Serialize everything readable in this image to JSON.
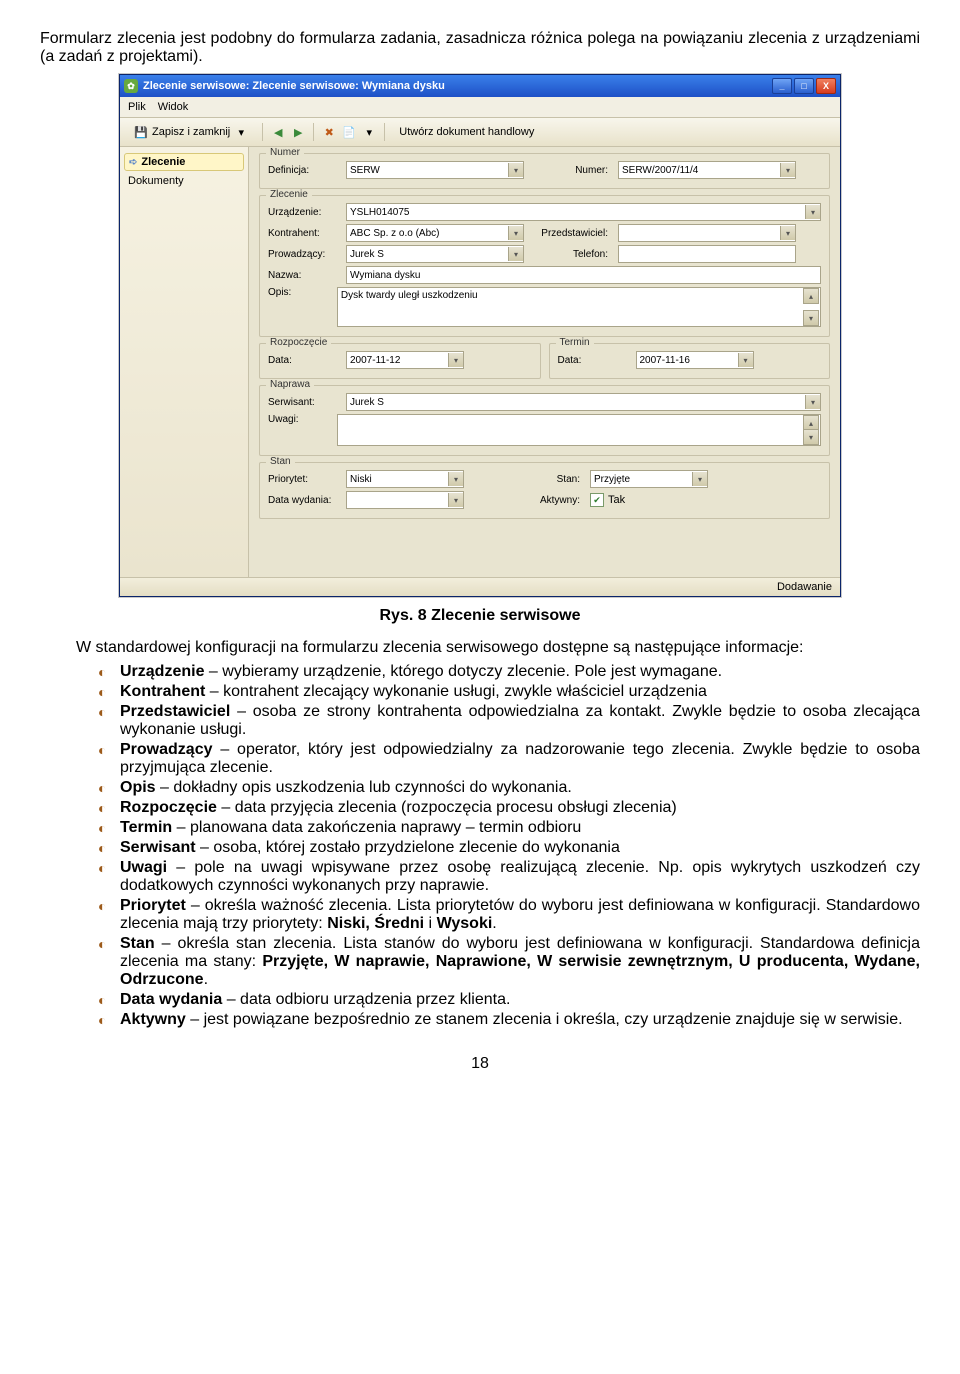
{
  "intro_text": "Formularz zlecenia jest podobny do formularza zadania, zasadnicza różnica polega na powiązaniu zlecenia z urządzeniami (a zadań z projektami).",
  "window": {
    "title": "Zlecenie serwisowe: Zlecenie serwisowe: Wymiana dysku",
    "win_min": "_",
    "win_max": "□",
    "win_close": "X",
    "menubar": {
      "plik": "Plik",
      "widok": "Widok"
    },
    "toolbar": {
      "save_close": "Zapisz i zamknij",
      "create_doc": "Utwórz dokument handlowy"
    },
    "sidebar": {
      "zlecenie": "Zlecenie",
      "dokumenty": "Dokumenty"
    },
    "form": {
      "numer_group": "Numer",
      "definicja_label": "Definicja:",
      "definicja_value": "SERW",
      "numer_label": "Numer:",
      "numer_value": "SERW/2007/11/4",
      "zlecenie_group": "Zlecenie",
      "urzadzenie_label": "Urządzenie:",
      "urzadzenie_value": "YSLH014075",
      "kontrahent_label": "Kontrahent:",
      "kontrahent_value": "ABC Sp. z o.o (Abc)",
      "przedstawiciel_label": "Przedstawiciel:",
      "przedstawiciel_value": "",
      "prowadzacy_label": "Prowadzący:",
      "prowadzacy_value": "Jurek S",
      "telefon_label": "Telefon:",
      "telefon_value": "",
      "nazwa_label": "Nazwa:",
      "nazwa_value": "Wymiana dysku",
      "opis_label": "Opis:",
      "opis_value": "Dysk twardy uległ uszkodzeniu",
      "rozpoczecie_group": "Rozpoczęcie",
      "termin_group": "Termin",
      "data_label": "Data:",
      "rozp_data_value": "2007-11-12",
      "term_data_value": "2007-11-16",
      "naprawa_group": "Naprawa",
      "serwisant_label": "Serwisant:",
      "serwisant_value": "Jurek S",
      "uwagi_label": "Uwagi:",
      "uwagi_value": "",
      "stan_group": "Stan",
      "priorytet_label": "Priorytet:",
      "priorytet_value": "Niski",
      "stan_label": "Stan:",
      "stan_value": "Przyjęte",
      "data_wydania_label": "Data wydania:",
      "data_wydania_value": "",
      "aktywny_label": "Aktywny:",
      "tak": "Tak"
    },
    "status": "Dodawanie"
  },
  "caption": "Rys. 8 Zlecenie serwisowe",
  "intro2a": "W standardowej konfiguracji na formularzu zlecenia serwisowego dostępne są następujące informacje:",
  "bullets": [
    {
      "bold": "Urządzenie",
      "text": " – wybieramy urządzenie, którego dotyczy zlecenie. Pole jest wymagane."
    },
    {
      "bold": "Kontrahent",
      "text": " – kontrahent zlecający wykonanie usługi, zwykle właściciel urządzenia"
    },
    {
      "bold": "Przedstawiciel",
      "text": " – osoba ze strony kontrahenta odpowiedzialna za kontakt. Zwykle będzie to osoba zlecająca wykonanie usługi."
    },
    {
      "bold": "Prowadzący",
      "text": " – operator, który jest odpowiedzialny za nadzorowanie tego zlecenia. Zwykle będzie to osoba przyjmująca zlecenie."
    },
    {
      "bold": "Opis",
      "text": " – dokładny opis uszkodzenia lub czynności do wykonania."
    },
    {
      "bold": "Rozpoczęcie",
      "text": " – data przyjęcia zlecenia (rozpoczęcia procesu obsługi zlecenia)"
    },
    {
      "bold": "Termin",
      "text": " – planowana data zakończenia naprawy – termin odbioru"
    },
    {
      "bold": "Serwisant",
      "text": " – osoba, której zostało przydzielone zlecenie do wykonania"
    },
    {
      "bold": "Uwagi",
      "text": " – pole na uwagi wpisywane przez osobę realizującą zlecenie. Np. opis wykrytych uszkodzeń czy dodatkowych czynności wykonanych przy naprawie."
    },
    {
      "bold": "Priorytet",
      "text": " – określa ważność zlecenia. Lista priorytetów do wyboru jest definiowana w konfiguracji. Standardowo zlecenia mają trzy priorytety: ",
      "tail_bold": "Niski, Średni",
      "tail_mid": " i ",
      "tail_bold2": "Wysoki",
      "period": "."
    },
    {
      "bold": "Stan",
      "text": " – określa stan zlecenia. Lista stanów do wyboru jest definiowana w konfiguracji. Standardowa definicja zlecenia ma stany: ",
      "tail_bold": "Przyjęte, W naprawie, Naprawione, W serwisie zewnętrznym, U producenta, Wydane, Odrzucone",
      "period": "."
    },
    {
      "bold": "Data wydania",
      "text": " – data odbioru urządzenia przez klienta."
    },
    {
      "bold": "Aktywny",
      "text": " – jest powiązane bezpośrednio ze stanem zlecenia i określa, czy urządzenie znajduje się w serwisie."
    }
  ],
  "page_number": "18"
}
